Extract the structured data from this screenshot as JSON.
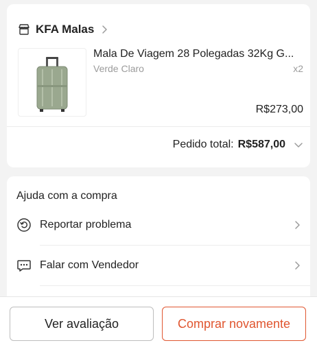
{
  "shop": {
    "name": "KFA Malas",
    "icon": "store-icon"
  },
  "product": {
    "title": "Mala De Viagem 28 Polegadas 32Kg G...",
    "variant": "Verde Claro",
    "quantity": "x2",
    "price": "R$273,00",
    "image": "suitcase-image"
  },
  "total": {
    "label": "Pedido total:",
    "value": "R$587,00"
  },
  "help": {
    "title": "Ajuda com a compra",
    "items": [
      {
        "label": "Reportar problema",
        "icon": "report-problem-icon"
      },
      {
        "label": "Falar com Vendedor",
        "icon": "chat-icon"
      }
    ]
  },
  "actions": {
    "review_label": "Ver avaliação",
    "rebuy_label": "Comprar novamente"
  },
  "colors": {
    "accent": "#e0552f",
    "background": "#f3f3f3",
    "muted_text": "#9b9b9b"
  }
}
